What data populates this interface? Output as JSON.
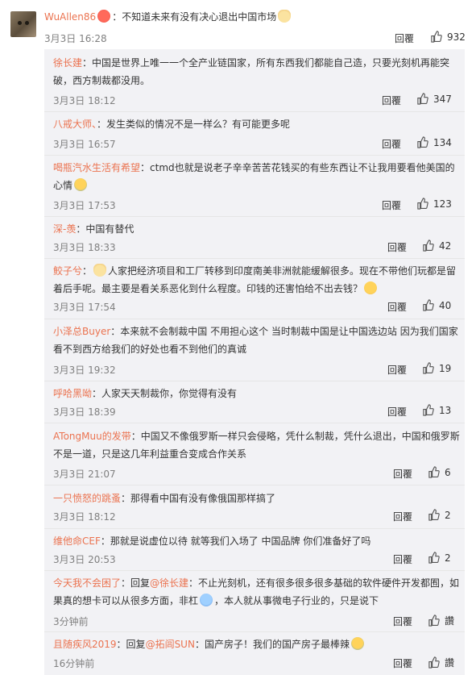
{
  "main": {
    "username": "WuAllen86",
    "text": "：不知道未来有没有决心退出中国市场",
    "time": "3月3日 16:28",
    "reply_label": "回覆",
    "likes": "932"
  },
  "replies": [
    {
      "username": "徐长建",
      "text": "：中国是世界上唯一一个全产业链国家，所有东西我们都能自己造，只要光刻机再能突破，西方制裁都没用。",
      "time": "3月3日 18:12",
      "reply_label": "回覆",
      "likes": "347"
    },
    {
      "username": "八戒大师、",
      "text": "：发生类似的情况不是一样么？有可能更多呢",
      "time": "3月3日 16:57",
      "reply_label": "回覆",
      "likes": "134"
    },
    {
      "username": "喝瓶汽水生活有希望",
      "text": "：ctmd也就是说老子辛辛苦苦花钱买的有些东西让不让我用要看他美国的心情",
      "time": "3月3日 17:53",
      "reply_label": "回覆",
      "likes": "123"
    },
    {
      "username": "深-羡",
      "text": "：中国有替代",
      "time": "3月3日 18:33",
      "reply_label": "回覆",
      "likes": "42"
    },
    {
      "username": "鲛子兮",
      "text": "人家把经济项目和工厂转移到印度南美非洲就能缓解很多。现在不带他们玩都是留着后手呢。最主要是看关系恶化到什么程度。印钱的还害怕给不出去钱？",
      "time": "3月3日 17:54",
      "reply_label": "回覆",
      "likes": "40"
    },
    {
      "username": "小泽总Buyer",
      "text": "：本来就不会制裁中国 不用担心这个 当时制裁中国是让中国选边站 因为我们国家看不到西方给我们的好处也看不到他们的真诚",
      "time": "3月3日 19:32",
      "reply_label": "回覆",
      "likes": "19"
    },
    {
      "username": "呼哈黑呦",
      "text": "：人家天天制裁你，你觉得有没有",
      "time": "3月3日 18:39",
      "reply_label": "回覆",
      "likes": "13"
    },
    {
      "username": "ATongMuu的发带",
      "text": "：中国又不像俄罗斯一样只会侵略，凭什么制裁，凭什么退出，中国和俄罗斯不是一道，只是这几年利益重合变成合作关系",
      "time": "3月3日 21:07",
      "reply_label": "回覆",
      "likes": "6"
    },
    {
      "username": "一只愤怒的跳蚤",
      "text": "：那得看中国有没有像俄国那样搞了",
      "time": "3月3日 18:12",
      "reply_label": "回覆",
      "likes": "2"
    },
    {
      "username": "维他命CEF",
      "text": "：那就是说虚位以待 就等我们入场了 中国品牌 你们准备好了吗",
      "time": "3月3日 20:53",
      "reply_label": "回覆",
      "likes": "2"
    },
    {
      "username": "今天我不会困了",
      "text_pre": "：回复",
      "mention": "@徐长建",
      "text": "：不止光刻机，还有很多很多很多基础的软件硬件开发都囿，如果真的想卡可以从很多方面，非杠",
      "text_post": "，本人就从事微电子行业的，只是说下",
      "time": "3分钟前",
      "reply_label": "回覆",
      "likes": "讚"
    },
    {
      "username": "且随疾风2019",
      "text_pre": "：回复",
      "mention": "@拓闾SUN",
      "text": "：国产房子！我们的国产房子最棒辣",
      "time": "16分钟前",
      "reply_label": "回覆",
      "likes": "讚"
    }
  ],
  "colors": {
    "username": "#eb7350",
    "meta": "#808080",
    "reply_bg": "#f2f2f5",
    "divider": "#e6e6e6"
  },
  "icons": [
    "thumbs-up-icon",
    "emoji-icon"
  ]
}
